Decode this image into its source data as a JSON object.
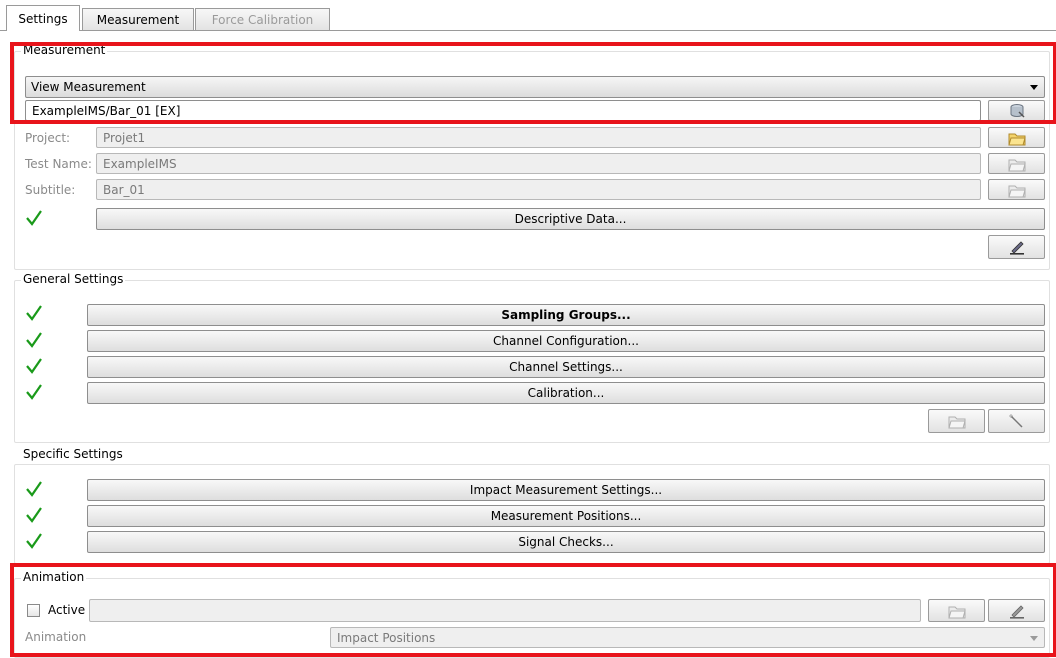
{
  "tabs": [
    {
      "label": "Settings",
      "state": "active"
    },
    {
      "label": "Measurement",
      "state": "normal"
    },
    {
      "label": "Force Calibration",
      "state": "disabled"
    }
  ],
  "measurement": {
    "title": "Measurement",
    "mode_select": "View Measurement",
    "path_value": "ExampleIMS/Bar_01 [EX]",
    "project_label": "Project:",
    "project_value": "Projet1",
    "test_name_label": "Test Name:",
    "test_name_value": "ExampleIMS",
    "subtitle_label": "Subtitle:",
    "subtitle_value": "Bar_01",
    "descriptive_button": "Descriptive Data..."
  },
  "general": {
    "title": "General Settings",
    "buttons": [
      "Sampling Groups...",
      "Channel Configuration...",
      "Channel Settings...",
      "Calibration..."
    ]
  },
  "specific": {
    "title": "Specific Settings",
    "buttons": [
      "Impact Measurement Settings...",
      "Measurement Positions...",
      "Signal Checks..."
    ]
  },
  "animation": {
    "title": "Animation",
    "active_label": "Active",
    "active_checked": false,
    "animation_label": "Animation",
    "animation_select": "Impact Positions"
  },
  "colors": {
    "highlight": "#e8141b",
    "check": "#1a9a1a"
  },
  "icons": [
    "folder-open-icon",
    "folder-icon",
    "database-icon",
    "edit-pen-icon",
    "wand-icon",
    "checkmark-icon"
  ]
}
